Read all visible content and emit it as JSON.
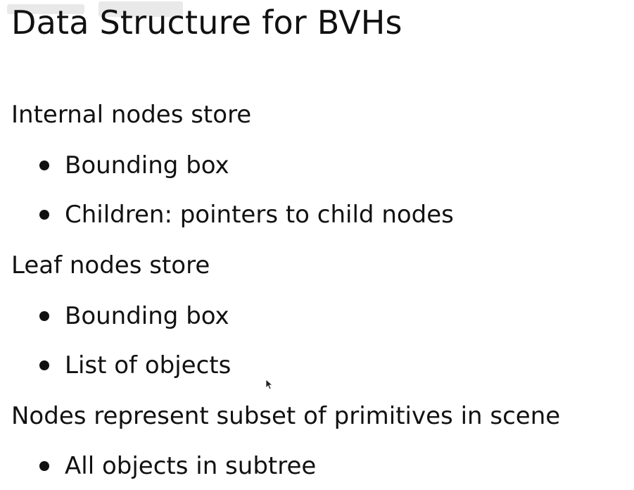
{
  "slide": {
    "title": "Data Structure for BVHs",
    "sections": [
      {
        "heading": "Internal nodes store",
        "bullets": [
          "Bounding box",
          "Children: pointers to child nodes"
        ]
      },
      {
        "heading": "Leaf nodes store",
        "bullets": [
          "Bounding box",
          "List of objects"
        ]
      },
      {
        "heading": "Nodes represent subset of primitives in scene",
        "bullets": [
          "All objects in subtree"
        ]
      }
    ]
  },
  "icons": {
    "cursor": "mouse-pointer-icon",
    "watermark": "watermark-logo"
  }
}
